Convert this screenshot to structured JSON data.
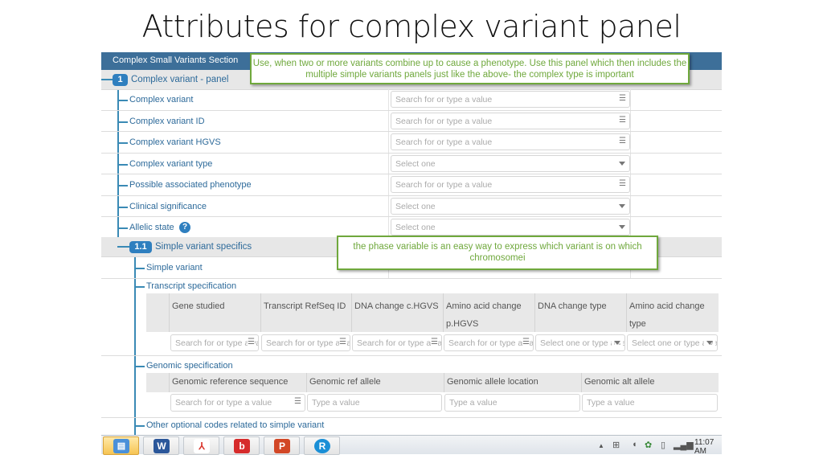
{
  "slide": {
    "title": "Attributes for complex variant panel"
  },
  "section": {
    "title": "Complex Small Variants Section"
  },
  "panel": {
    "badge": "1",
    "title": "Complex variant - panel"
  },
  "callouts": {
    "top": "Use, when two or more variants combine up to cause a phenotype. Use this panel which then includes the multiple simple variants panels just like the above- the complex  type is important",
    "phase": "the phase variable is an easy way to express which variant is on which chromosomei"
  },
  "fields": [
    {
      "label": "Complex variant",
      "type": "search",
      "placeholder": "Search for or type a value"
    },
    {
      "label": "Complex variant ID",
      "type": "search",
      "placeholder": "Search for or type a value"
    },
    {
      "label": "Complex variant HGVS",
      "type": "search",
      "placeholder": "Search for or type a value"
    },
    {
      "label": "Complex variant type",
      "type": "select",
      "placeholder": "Select one"
    },
    {
      "label": "Possible associated phenotype",
      "type": "search",
      "placeholder": "Search for or type a value"
    },
    {
      "label": "Clinical significance",
      "type": "select",
      "placeholder": "Select one"
    },
    {
      "label": "Allelic state",
      "type": "select",
      "placeholder": "Select one",
      "help": "?"
    }
  ],
  "subpanel": {
    "badge": "1.1",
    "title": "Simple variant specifics",
    "simple_variant_label": "Simple variant",
    "transcript": {
      "title": "Transcript specification",
      "columns": [
        "Gene studied",
        "Transcript RefSeq ID",
        "DNA change c.HGVS",
        "Amino acid change p.HGVS",
        "DNA change type",
        "Amino acid change type"
      ],
      "inputs": [
        "Search for or type a value",
        "Search for or type a value",
        "Search for or type a value",
        "Search for or type a value",
        "Select one or type a value",
        "Select one or type a value"
      ]
    },
    "genomic": {
      "title": "Genomic specification",
      "columns": [
        "Genomic reference sequence",
        "Genomic ref allele",
        "Genomic allele location",
        "Genomic alt allele"
      ],
      "inputs": [
        "Search for or type a value",
        "Type a value",
        "Type a value",
        "Type a value"
      ]
    },
    "other_codes_label": "Other optional codes related to simple variant"
  },
  "taskbar": {
    "apps": [
      {
        "name": "control-panel",
        "glyph": "▤"
      },
      {
        "name": "word",
        "glyph": "W"
      },
      {
        "name": "acrobat",
        "glyph": "⅄"
      },
      {
        "name": "beacon",
        "glyph": "b"
      },
      {
        "name": "powerpoint",
        "glyph": "P"
      },
      {
        "name": "r-app",
        "glyph": "R"
      }
    ],
    "time": "11:07 AM",
    "colors": {
      "word": "#2b579a",
      "acrobat": "#d9342b",
      "beacon": "#d62b2b",
      "powerpoint": "#d24726",
      "r-app": "#1a8fd6"
    }
  }
}
